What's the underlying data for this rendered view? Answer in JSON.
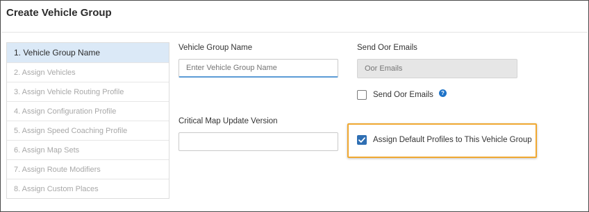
{
  "dialog": {
    "title": "Create Vehicle Group"
  },
  "steps": [
    "1.  Vehicle Group Name",
    "2.  Assign Vehicles",
    "3.  Assign Vehicle Routing Profile",
    "4.  Assign Configuration Profile",
    "5.  Assign Speed Coaching Profile",
    "6.  Assign Map Sets",
    "7.  Assign Route Modifiers",
    "8.  Assign Custom Places"
  ],
  "active_step": 0,
  "form": {
    "vehicle_group_name": {
      "label": "Vehicle Group Name",
      "placeholder": "Enter Vehicle Group Name",
      "value": ""
    },
    "send_oor_emails": {
      "label": "Send Oor Emails",
      "placeholder": "Oor Emails",
      "value": ""
    },
    "send_oor_checkbox": {
      "label": "Send Oor Emails",
      "checked": false,
      "help_icon": "?"
    },
    "critical_map_update": {
      "label": "Critical Map Update Version",
      "value": ""
    },
    "assign_default_profiles": {
      "label": "Assign Default Profiles to This Vehicle Group",
      "checked": true
    }
  },
  "colors": {
    "active_step_bg": "#dbe9f7",
    "checkbox_checked": "#2f6fb3",
    "highlight_border": "#f0a830",
    "help_icon": "#1e73c8"
  }
}
